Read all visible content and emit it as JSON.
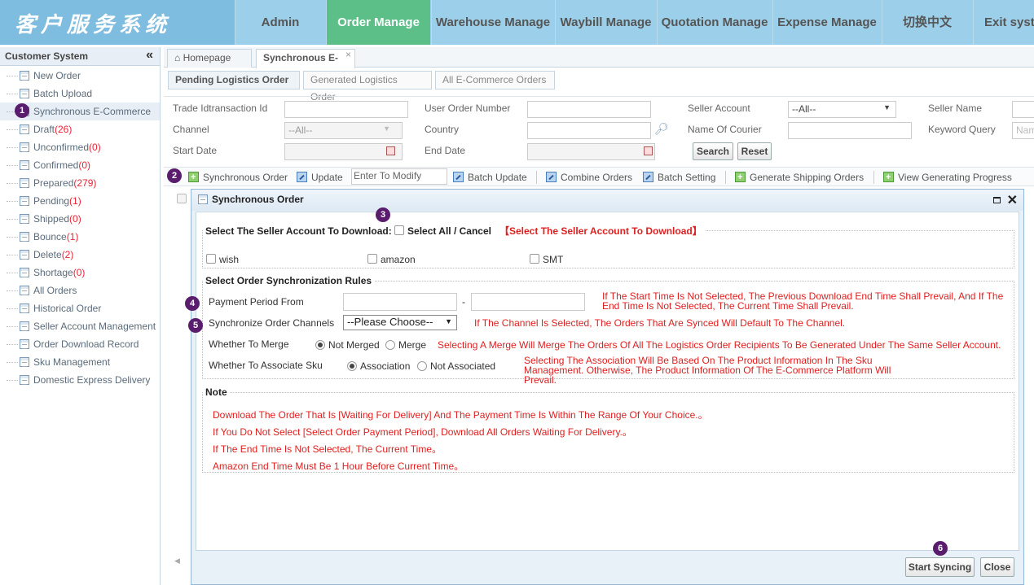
{
  "header": {
    "logo": "客户服务系统",
    "nav": [
      "Admin",
      "Order Manage",
      "Warehouse Manage",
      "Waybill Manage",
      "Quotation Manage",
      "Expense Manage",
      "切换中文",
      "Exit syst"
    ]
  },
  "sidebar": {
    "title": "Customer System",
    "collapse_glyph": "«",
    "items": [
      {
        "label": "New Order",
        "count": ""
      },
      {
        "label": "Batch Upload",
        "count": ""
      },
      {
        "label": "Synchronous E-Commerce",
        "count": ""
      },
      {
        "label": "Draft",
        "count": "(26)"
      },
      {
        "label": "Unconfirmed",
        "count": "(0)"
      },
      {
        "label": "Confirmed",
        "count": "(0)"
      },
      {
        "label": "Prepared",
        "count": "(279)"
      },
      {
        "label": "Pending",
        "count": "(1)"
      },
      {
        "label": "Shipped",
        "count": "(0)"
      },
      {
        "label": "Bounce",
        "count": "(1)"
      },
      {
        "label": "Delete",
        "count": "(2)"
      },
      {
        "label": "Shortage",
        "count": "(0)"
      },
      {
        "label": "All Orders",
        "count": ""
      },
      {
        "label": "Historical Order",
        "count": ""
      },
      {
        "label": "Seller Account Management",
        "count": ""
      },
      {
        "label": "Order Download Record",
        "count": ""
      },
      {
        "label": "Sku Management",
        "count": ""
      },
      {
        "label": "Domestic Express Delivery",
        "count": ""
      }
    ]
  },
  "tabs": {
    "home": "Homepage",
    "active": "Synchronous E-",
    "close_glyph": "×"
  },
  "subtabs": [
    "Pending Logistics Order",
    "Generated Logistics Order",
    "All E-Commerce Orders"
  ],
  "filters": {
    "trade_id": "Trade Idtransaction Id",
    "user_order": "User Order Number",
    "seller_account": "Seller Account",
    "seller_account_value": "--All--",
    "seller_name": "Seller Name",
    "channel": "Channel",
    "channel_value": "--All--",
    "country": "Country",
    "courier": "Name Of Courier",
    "keyword": "Keyword Query",
    "keyword_placeholder": "Nam",
    "start_date": "Start Date",
    "end_date": "End Date",
    "search": "Search",
    "reset": "Reset"
  },
  "toolbar": {
    "sync": "Synchronous Order",
    "update": "Update",
    "modify_placeholder": "Enter To Modify",
    "batch_update": "Batch Update",
    "combine": "Combine Orders",
    "batch_setting": "Batch Setting",
    "generate": "Generate Shipping Orders",
    "progress": "View Generating Progress"
  },
  "dialog": {
    "title": "Synchronous Order",
    "seller_legend": "Select The Seller Account To Download:",
    "select_all": "Select All / Cancel",
    "seller_hint": "【Select The Seller Account To Download】",
    "accounts": [
      "wish",
      "amazon",
      "SMT"
    ],
    "rules_legend": "Select Order Synchronization Rules",
    "payment_label": "Payment Period From",
    "dash": "-",
    "payment_hint": "If The Start Time Is Not Selected, The Previous Download End Time Shall Prevail, And If The End Time Is Not Selected, The Current Time Shall Prevail.",
    "channels_label": "Synchronize Order Channels",
    "channels_value": "--Please Choose--",
    "channels_hint": "If The Channel Is Selected, The Orders That Are Synced Will Default To The Channel.",
    "merge_label": "Whether To Merge",
    "not_merged": "Not Merged",
    "merge": "Merge",
    "merge_hint": "Selecting A Merge Will Merge The Orders Of All The Logistics Order Recipients To Be Generated Under The Same Seller Account.",
    "sku_label": "Whether To Associate Sku",
    "association": "Association",
    "not_associated": "Not Associated",
    "sku_hint": "Selecting The Association Will Be Based On The Product Information In The Sku Management. Otherwise, The Product Information Of The E-Commerce Platform Will Prevail.",
    "note_legend": "Note",
    "notes": [
      "Download The Order That Is [Waiting For Delivery] And The Payment Time Is Within The Range Of Your Choice.。",
      "If You Do Not Select [Select Order Payment Period], Download All Orders Waiting For Delivery.。",
      "If The End Time Is Not Selected, The Current Time。",
      "Amazon End Time Must Be 1 Hour Before Current Time。"
    ],
    "start": "Start Syncing",
    "close": "Close"
  },
  "badges": [
    "1",
    "2",
    "3",
    "4",
    "5",
    "6"
  ],
  "colors": {
    "accent_green": "#5cbf88",
    "header_blue": "#9ccfe9",
    "hint_red": "#e02020",
    "badge_purple": "#5a1d6e"
  }
}
